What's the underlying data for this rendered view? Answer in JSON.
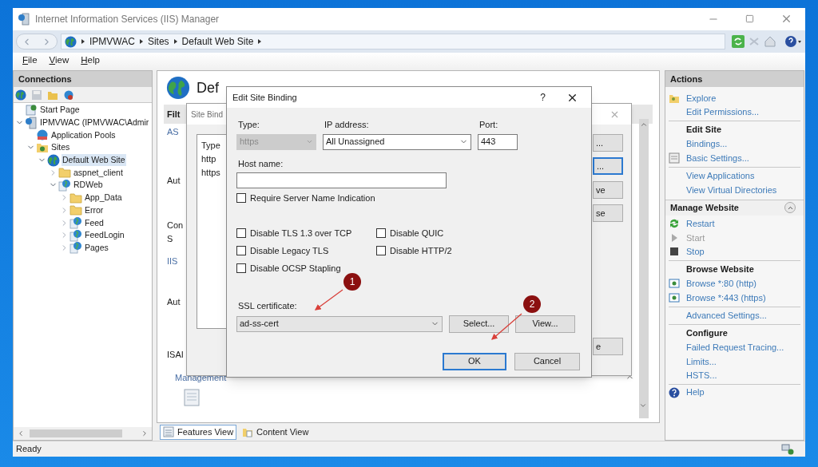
{
  "window": {
    "title": "Internet Information Services (IIS) Manager"
  },
  "address_bar": {
    "breadcrumb": [
      "IPMVWAC",
      "Sites",
      "Default Web Site"
    ]
  },
  "menu": [
    "File",
    "View",
    "Help"
  ],
  "connections": {
    "title": "Connections",
    "tree": [
      {
        "label": "Start Page",
        "kind": "page",
        "selected": false
      },
      {
        "label": "IPMVWAC (IPMVWAC\\Admir",
        "kind": "server",
        "expanded": true,
        "selected": false,
        "children": [
          {
            "label": "Application Pools",
            "kind": "pool",
            "selected": false
          },
          {
            "label": "Sites",
            "kind": "sites",
            "expanded": true,
            "selected": false,
            "children": [
              {
                "label": "Default Web Site",
                "kind": "site",
                "expanded": true,
                "selected": true,
                "children": [
                  {
                    "label": "aspnet_client",
                    "kind": "folder",
                    "expanded": false,
                    "selected": false
                  },
                  {
                    "label": "RDWeb",
                    "kind": "app",
                    "expanded": true,
                    "selected": false,
                    "children": [
                      {
                        "label": "App_Data",
                        "kind": "folder",
                        "expanded": false,
                        "selected": false
                      },
                      {
                        "label": "Error",
                        "kind": "folder",
                        "expanded": false,
                        "selected": false
                      },
                      {
                        "label": "Feed",
                        "kind": "app",
                        "expanded": false,
                        "selected": false
                      },
                      {
                        "label": "FeedLogin",
                        "kind": "app",
                        "expanded": false,
                        "selected": false
                      },
                      {
                        "label": "Pages",
                        "kind": "app",
                        "expanded": false,
                        "selected": false
                      }
                    ]
                  }
                ]
              }
            ]
          }
        ]
      }
    ]
  },
  "center": {
    "title": "Def",
    "filter": "Filt",
    "fragments": [
      {
        "text": "AS",
        "kind": "group"
      },
      {
        "text": "Aut",
        "kind": "feature"
      },
      {
        "text": "Con",
        "kind": "feature"
      },
      {
        "text": "S",
        "kind": "feature"
      },
      {
        "text": "IIS",
        "kind": "group"
      },
      {
        "text": "Aut",
        "kind": "feature"
      },
      {
        "text": "ISAI",
        "kind": "feature"
      }
    ],
    "group": "Management",
    "views": [
      {
        "label": "Features View",
        "selected": true
      },
      {
        "label": "Content View",
        "selected": false
      }
    ]
  },
  "site_bindings": {
    "title": "Site Bind",
    "column": "Type",
    "rows": [
      "http",
      "https"
    ],
    "buttons": [
      {
        "label": "...",
        "focused": false
      },
      {
        "label": "...",
        "focused": true
      },
      {
        "label": "ve",
        "focused": false
      },
      {
        "label": "se",
        "focused": false
      },
      {
        "label": "e",
        "focused": false
      }
    ]
  },
  "edit_binding": {
    "title": "Edit Site Binding",
    "help": "?",
    "type": {
      "label": "Type:",
      "value": "https",
      "disabled": true
    },
    "ip": {
      "label": "IP address:",
      "value": "All Unassigned"
    },
    "port": {
      "label": "Port:",
      "value": "443"
    },
    "host": {
      "label": "Host name:"
    },
    "sni": {
      "label": "Require Server Name Indication",
      "checked": false
    },
    "options": [
      {
        "label": "Disable TLS 1.3 over TCP",
        "checked": false
      },
      {
        "label": "Disable QUIC",
        "checked": false
      },
      {
        "label": "Disable Legacy TLS",
        "checked": false
      },
      {
        "label": "Disable HTTP/2",
        "checked": false
      },
      {
        "label": "Disable OCSP Stapling",
        "checked": false
      }
    ],
    "ssl": {
      "label": "SSL certificate:",
      "value": "ad-ss-cert"
    },
    "select_button": "Select...",
    "view_button": "View...",
    "ok_button": "OK",
    "cancel_button": "Cancel"
  },
  "annotations": [
    {
      "label": "1"
    },
    {
      "label": "2"
    }
  ],
  "actions": {
    "title": "Actions",
    "groups": [
      {
        "items": [
          {
            "label": "Explore",
            "kind": "explore",
            "disabled": false
          },
          {
            "label": "Edit Permissions...",
            "disabled": false
          }
        ]
      },
      {
        "heading": "Edit Site",
        "items": [
          {
            "label": "Bindings...",
            "disabled": false
          },
          {
            "label": "Basic Settings...",
            "kind": "settings",
            "disabled": false
          }
        ]
      },
      {
        "items": [
          {
            "label": "View Applications",
            "disabled": false
          },
          {
            "label": "View Virtual Directories",
            "disabled": false
          }
        ]
      }
    ]
  },
  "manage": {
    "title": "Manage Website",
    "groups": [
      {
        "items": [
          {
            "label": "Restart",
            "kind": "restart",
            "disabled": false
          },
          {
            "label": "Start",
            "kind": "start",
            "disabled": true
          },
          {
            "label": "Stop",
            "kind": "stop",
            "disabled": false
          }
        ]
      },
      {
        "heading": "Browse Website",
        "items": [
          {
            "label": "Browse *:80 (http)",
            "kind": "browse",
            "disabled": false
          },
          {
            "label": "Browse *:443 (https)",
            "kind": "browse",
            "disabled": false
          }
        ]
      },
      {
        "items": [
          {
            "label": "Advanced Settings...",
            "disabled": false
          }
        ]
      },
      {
        "heading": "Configure",
        "items": [
          {
            "label": "Failed Request Tracing...",
            "disabled": false
          },
          {
            "label": "Limits...",
            "disabled": false
          },
          {
            "label": "HSTS...",
            "disabled": false
          }
        ]
      }
    ]
  },
  "help": {
    "label": "Help",
    "kind": "help"
  },
  "status_bar": {
    "text": "Ready"
  }
}
